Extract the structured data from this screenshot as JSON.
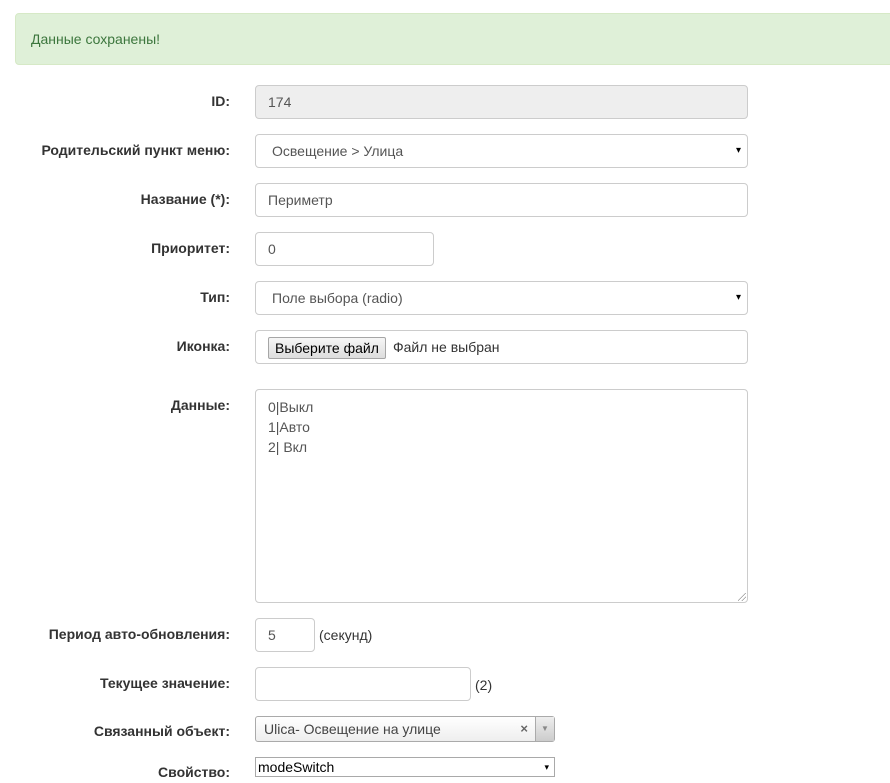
{
  "alert": {
    "message": "Данные сохранены!"
  },
  "form": {
    "id": {
      "label": "ID:",
      "value": "174"
    },
    "parent": {
      "label": "Родительский пункт меню:",
      "value": "Освещение > Улица"
    },
    "title": {
      "label": "Название (*):",
      "value": "Периметр"
    },
    "priority": {
      "label": "Приоритет:",
      "value": "0"
    },
    "type": {
      "label": "Тип:",
      "value": "Поле выбора (radio)"
    },
    "icon": {
      "label": "Иконка:",
      "button": "Выберите файл",
      "status": "Файл не выбран"
    },
    "data": {
      "label": "Данные:",
      "lines": [
        "0|Выкл",
        "1|Авто",
        "2| Вкл"
      ]
    },
    "refresh": {
      "label": "Период авто-обновления:",
      "value": "5",
      "suffix": "(секунд)"
    },
    "current": {
      "label": "Текущее значение:",
      "value": "",
      "suffix": "(2)"
    },
    "linked_object": {
      "label": "Связанный объект:",
      "value": "Ulica- Освещение на улице"
    },
    "property": {
      "label": "Свойство:",
      "value": "modeSwitch"
    }
  },
  "icons": {
    "select_arrow": "▾",
    "clear": "×",
    "combo_arrow": "▼"
  }
}
